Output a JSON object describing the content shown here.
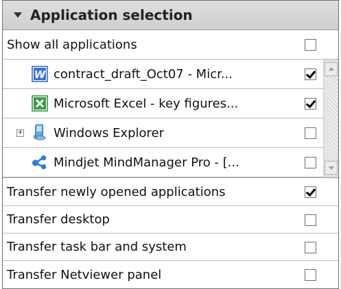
{
  "panel": {
    "title": "Application selection",
    "show_all": {
      "label": "Show all applications",
      "checked": false
    },
    "applications": [
      {
        "label": "contract_draft_Oct07 - Micr...",
        "icon": "word-icon",
        "checked": true,
        "expandable": false
      },
      {
        "label": "Microsoft Excel - key figures...",
        "icon": "excel-icon",
        "checked": true,
        "expandable": false
      },
      {
        "label": "Windows Explorer",
        "icon": "explorer-icon",
        "checked": false,
        "expandable": true
      },
      {
        "label": "Mindjet MindManager Pro - [...",
        "icon": "mindmanager-icon",
        "checked": false,
        "expandable": false
      }
    ],
    "options": [
      {
        "label": "Transfer newly opened applications",
        "checked": true
      },
      {
        "label": "Transfer desktop",
        "checked": false
      },
      {
        "label": "Transfer task bar and system",
        "checked": false
      },
      {
        "label": "Transfer Netviewer panel",
        "checked": false
      }
    ],
    "expand_symbol": "+"
  },
  "colors": {
    "header_bg": "#d6d6d6",
    "border": "#6f6f6f",
    "word_blue": "#2f5fc4",
    "excel_green": "#2f8a3e",
    "mindjet_blue": "#2b7fd8"
  }
}
